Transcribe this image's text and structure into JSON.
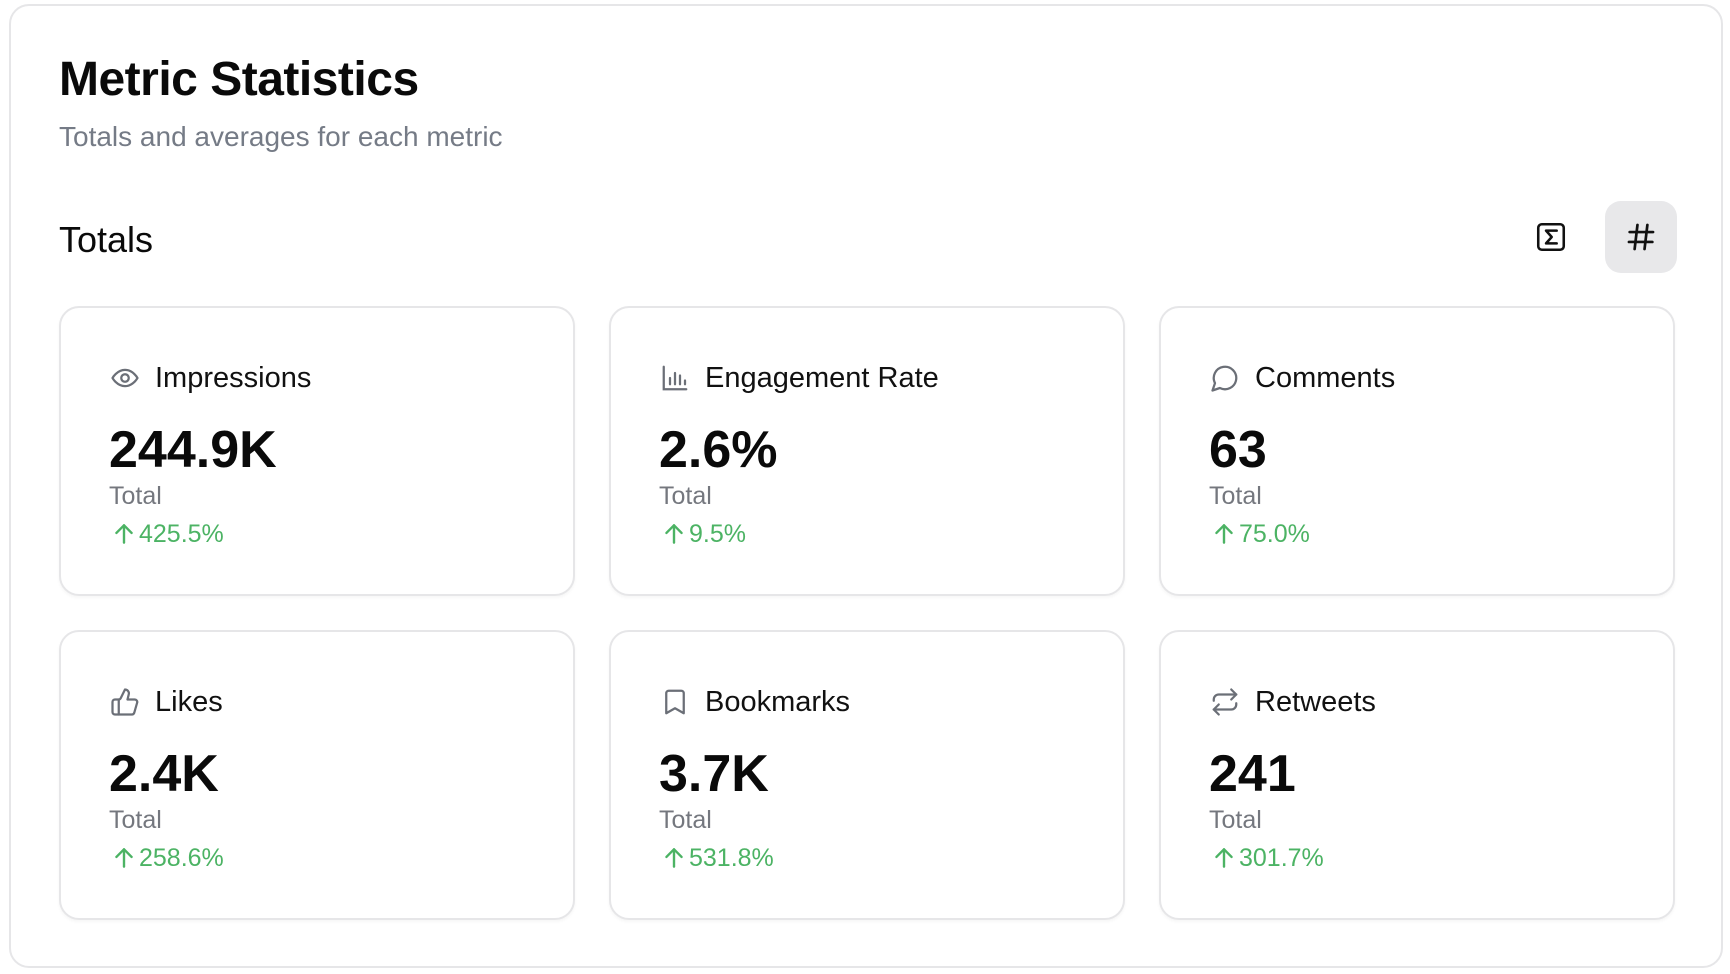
{
  "header": {
    "title": "Metric Statistics",
    "subtitle": "Totals and averages for each metric"
  },
  "section": {
    "title": "Totals",
    "view_toggle": {
      "options": [
        {
          "icon": "sigma-icon",
          "active": false
        },
        {
          "icon": "hash-icon",
          "active": true
        }
      ]
    }
  },
  "colors": {
    "positive_change": "#4cb364",
    "muted_text": "#757b86",
    "active_toggle_bg": "#e8e8ea"
  },
  "cards": [
    {
      "label": "Impressions",
      "icon": "eye-icon",
      "value": "244.9K",
      "caption": "Total",
      "change": "425.5%",
      "direction": "up"
    },
    {
      "label": "Engagement Rate",
      "icon": "bar-chart-icon",
      "value": "2.6%",
      "caption": "Total",
      "change": "9.5%",
      "direction": "up"
    },
    {
      "label": "Comments",
      "icon": "comment-icon",
      "value": "63",
      "caption": "Total",
      "change": "75.0%",
      "direction": "up"
    },
    {
      "label": "Likes",
      "icon": "thumbs-up-icon",
      "value": "2.4K",
      "caption": "Total",
      "change": "258.6%",
      "direction": "up"
    },
    {
      "label": "Bookmarks",
      "icon": "bookmark-icon",
      "value": "3.7K",
      "caption": "Total",
      "change": "531.8%",
      "direction": "up"
    },
    {
      "label": "Retweets",
      "icon": "retweet-icon",
      "value": "241",
      "caption": "Total",
      "change": "301.7%",
      "direction": "up"
    }
  ]
}
